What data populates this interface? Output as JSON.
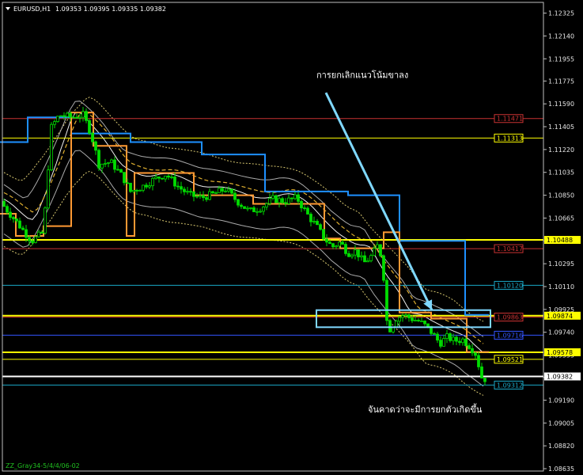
{
  "header": {
    "symbol": "EURUSD,H1",
    "ohlc": "1.09353 1.09395 1.09335 1.09382"
  },
  "footer": {
    "indicator_label": "ZZ_Gray34-5/4/4/06-02"
  },
  "colors": {
    "background": "#000000",
    "candle": "#00dd00",
    "step_blue": "#1e90ff",
    "step_orange": "#ff9933",
    "support_yellow": "#ffff00",
    "resistance_red": "#c83232",
    "cyan_line": "#1aa7c6",
    "arrow": "#7fd8ff",
    "box": "#7fd8ff"
  },
  "chart_data": {
    "type": "candlestick",
    "title": "EURUSD,H1",
    "ylim": [
      1.08635,
      1.12335
    ],
    "y_ticks": [
      "1.12325",
      "1.12140",
      "1.11955",
      "1.11775",
      "1.11590",
      "1.11405",
      "1.11220",
      "1.11035",
      "1.10850",
      "1.10665",
      "1.10480",
      "1.10295",
      "1.10110",
      "1.09925",
      "1.09740",
      "1.09555",
      "1.09375",
      "1.09190",
      "1.09005",
      "1.08820",
      "1.08635"
    ],
    "horizontal_lines": [
      {
        "price": 1.11471,
        "label": "1.11471",
        "color": "#c83232",
        "label_box": false
      },
      {
        "price": 1.11313,
        "label": "1.11313",
        "color": "#ffff00",
        "label_box": false
      },
      {
        "price": 1.10488,
        "label": "1.10488",
        "color": "#ffff00",
        "label_box": true
      },
      {
        "price": 1.10417,
        "label": "1.10417",
        "color": "#c83232",
        "label_box": false
      },
      {
        "price": 1.1012,
        "label": "1.10120",
        "color": "#1aa7c6",
        "label_box": false
      },
      {
        "price": 1.09874,
        "label": "1.09874",
        "color": "#ffff00",
        "label_box": true
      },
      {
        "price": 1.09863,
        "label": "1.09863",
        "color": "#c83232",
        "label_box": false
      },
      {
        "price": 1.09716,
        "label": "1.09716",
        "color": "#3355ff",
        "label_box": false
      },
      {
        "price": 1.09578,
        "label": "1.09578",
        "color": "#ffff00",
        "label_box": true
      },
      {
        "price": 1.09521,
        "label": "1.09521",
        "color": "#ffff00",
        "label_box": false
      },
      {
        "price": 1.09382,
        "label": "1.09382",
        "color": "#ffffff",
        "label_box": true
      },
      {
        "price": 1.09312,
        "label": "1.09312",
        "color": "#1aa7c6",
        "label_box": false
      }
    ],
    "price_path": [
      [
        0,
        1.108
      ],
      [
        25,
        1.106
      ],
      [
        40,
        1.1048
      ],
      [
        55,
        1.1055
      ],
      [
        60,
        1.11
      ],
      [
        65,
        1.114
      ],
      [
        75,
        1.115
      ],
      [
        90,
        1.1148
      ],
      [
        105,
        1.115
      ],
      [
        115,
        1.1135
      ],
      [
        125,
        1.111
      ],
      [
        140,
        1.1112
      ],
      [
        155,
        1.11
      ],
      [
        165,
        1.1088
      ],
      [
        180,
        1.1092
      ],
      [
        195,
        1.1098
      ],
      [
        210,
        1.1102
      ],
      [
        225,
        1.1092
      ],
      [
        240,
        1.1085
      ],
      [
        255,
        1.1083
      ],
      [
        270,
        1.1086
      ],
      [
        285,
        1.109
      ],
      [
        300,
        1.108
      ],
      [
        315,
        1.1072
      ],
      [
        330,
        1.1075
      ],
      [
        345,
        1.1082
      ],
      [
        360,
        1.108
      ],
      [
        375,
        1.1083
      ],
      [
        390,
        1.1068
      ],
      [
        400,
        1.106
      ],
      [
        410,
        1.105
      ],
      [
        420,
        1.1043
      ],
      [
        430,
        1.1047
      ],
      [
        440,
        1.1038
      ],
      [
        450,
        1.104
      ],
      [
        460,
        1.103
      ],
      [
        470,
        1.1036
      ],
      [
        478,
        1.1045
      ],
      [
        484,
        1.103
      ],
      [
        488,
        1.0985
      ],
      [
        494,
        1.0975
      ],
      [
        500,
        1.0985
      ],
      [
        510,
        1.0988
      ],
      [
        520,
        1.0985
      ],
      [
        530,
        1.0983
      ],
      [
        540,
        1.0978
      ],
      [
        548,
        1.0972
      ],
      [
        556,
        1.0965
      ],
      [
        565,
        1.097
      ],
      [
        575,
        1.0967
      ],
      [
        585,
        1.0968
      ],
      [
        595,
        1.0962
      ],
      [
        603,
        1.0955
      ],
      [
        607,
        1.094
      ],
      [
        611,
        1.0935
      ],
      [
        616,
        1.0938
      ]
    ],
    "step_blue": [
      [
        0,
        1.1128
      ],
      [
        35,
        1.1128
      ],
      [
        35,
        1.1148
      ],
      [
        90,
        1.1148
      ],
      [
        90,
        1.1135
      ],
      [
        165,
        1.1135
      ],
      [
        165,
        1.1128
      ],
      [
        255,
        1.1128
      ],
      [
        255,
        1.1118
      ],
      [
        335,
        1.1118
      ],
      [
        335,
        1.1088
      ],
      [
        440,
        1.1088
      ],
      [
        440,
        1.1085
      ],
      [
        505,
        1.1085
      ],
      [
        505,
        1.1048
      ],
      [
        588,
        1.1048
      ],
      [
        588,
        1.0988
      ],
      [
        618,
        1.0988
      ]
    ],
    "step_orange": [
      [
        0,
        1.107
      ],
      [
        20,
        1.107
      ],
      [
        20,
        1.1052
      ],
      [
        55,
        1.1052
      ],
      [
        55,
        1.106
      ],
      [
        90,
        1.106
      ],
      [
        90,
        1.1152
      ],
      [
        118,
        1.1152
      ],
      [
        118,
        1.1125
      ],
      [
        160,
        1.1125
      ],
      [
        160,
        1.1052
      ],
      [
        170,
        1.1052
      ],
      [
        170,
        1.1103
      ],
      [
        245,
        1.1103
      ],
      [
        245,
        1.1085
      ],
      [
        320,
        1.1085
      ],
      [
        320,
        1.1078
      ],
      [
        410,
        1.1078
      ],
      [
        410,
        1.105
      ],
      [
        430,
        1.105
      ],
      [
        430,
        1.1042
      ],
      [
        485,
        1.1042
      ],
      [
        485,
        1.1055
      ],
      [
        505,
        1.1055
      ],
      [
        505,
        1.099
      ],
      [
        545,
        1.099
      ],
      [
        545,
        1.0985
      ],
      [
        590,
        1.0985
      ],
      [
        590,
        1.0958
      ],
      [
        618,
        1.0958
      ]
    ],
    "annotations": [
      {
        "text": "การยกเลิกแนวโน้มขาลง",
        "x": 400,
        "price": 1.118
      },
      {
        "text": "จันคาดว่าจะมีการยกตัวเกิดขึ้น",
        "x": 465,
        "price": 1.0909
      }
    ],
    "arrow": {
      "from": [
        412,
        1.1168
      ],
      "to": [
        546,
        1.0992
      ]
    },
    "highlight_box": {
      "x1": 400,
      "x2": 620,
      "price_top": 1.099,
      "price_bottom": 1.098
    }
  }
}
